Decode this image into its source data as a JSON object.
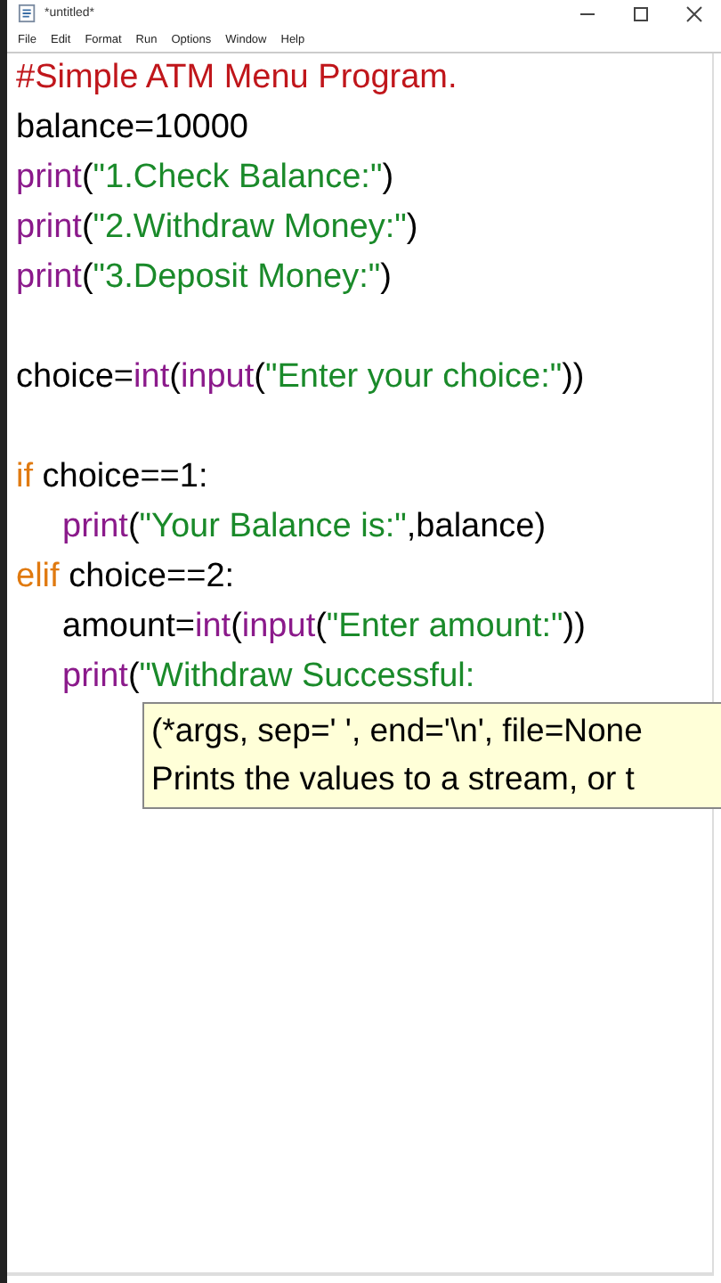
{
  "window": {
    "title": "*untitled*",
    "controls": [
      {
        "kind": "minimize"
      },
      {
        "kind": "maximize"
      },
      {
        "kind": "close"
      }
    ]
  },
  "menu": [
    "File",
    "Edit",
    "Format",
    "Run",
    "Options",
    "Window",
    "Help"
  ],
  "editor": {
    "lines": [
      {
        "kind": "code",
        "tokens": [
          {
            "kind": "comment",
            "text": "#Simple ATM Menu Program."
          }
        ]
      },
      {
        "kind": "code",
        "tokens": [
          {
            "kind": "plain",
            "text": "balance=10000"
          }
        ]
      },
      {
        "kind": "code",
        "tokens": [
          {
            "kind": "builtin",
            "text": "print"
          },
          {
            "kind": "plain",
            "text": "("
          },
          {
            "kind": "string",
            "text": "\"1.Check Balance:\""
          },
          {
            "kind": "plain",
            "text": ")"
          }
        ]
      },
      {
        "kind": "code",
        "tokens": [
          {
            "kind": "builtin",
            "text": "print"
          },
          {
            "kind": "plain",
            "text": "("
          },
          {
            "kind": "string",
            "text": "\"2.Withdraw Money:\""
          },
          {
            "kind": "plain",
            "text": ")"
          }
        ]
      },
      {
        "kind": "code",
        "tokens": [
          {
            "kind": "builtin",
            "text": "print"
          },
          {
            "kind": "plain",
            "text": "("
          },
          {
            "kind": "string",
            "text": "\"3.Deposit Money:\""
          },
          {
            "kind": "plain",
            "text": ")"
          }
        ]
      },
      {
        "kind": "blank"
      },
      {
        "kind": "code",
        "tokens": [
          {
            "kind": "plain",
            "text": "choice="
          },
          {
            "kind": "builtin",
            "text": "int"
          },
          {
            "kind": "plain",
            "text": "("
          },
          {
            "kind": "builtin",
            "text": "input"
          },
          {
            "kind": "plain",
            "text": "("
          },
          {
            "kind": "string",
            "text": "\"Enter your choice:\""
          },
          {
            "kind": "plain",
            "text": "))"
          }
        ]
      },
      {
        "kind": "blank"
      },
      {
        "kind": "code",
        "tokens": [
          {
            "kind": "keyword",
            "text": "if"
          },
          {
            "kind": "plain",
            "text": " choice==1:"
          }
        ],
        "children": [
          {
            "kind": "code",
            "tokens": [
              {
                "kind": "builtin",
                "text": "print"
              },
              {
                "kind": "plain",
                "text": "("
              },
              {
                "kind": "string",
                "text": "\"Your Balance is:\""
              },
              {
                "kind": "plain",
                "text": ",balance)"
              }
            ]
          }
        ]
      },
      {
        "kind": "code",
        "tokens": [
          {
            "kind": "keyword",
            "text": "elif"
          },
          {
            "kind": "plain",
            "text": " choice==2:"
          }
        ],
        "children": [
          {
            "kind": "code",
            "tokens": [
              {
                "kind": "plain",
                "text": "amount="
              },
              {
                "kind": "builtin",
                "text": "int"
              },
              {
                "kind": "plain",
                "text": "("
              },
              {
                "kind": "builtin",
                "text": "input"
              },
              {
                "kind": "plain",
                "text": "("
              },
              {
                "kind": "string",
                "text": "\"Enter amount:\""
              },
              {
                "kind": "plain",
                "text": "))"
              }
            ]
          },
          {
            "kind": "code",
            "tokens": [
              {
                "kind": "builtin",
                "text": "print"
              },
              {
                "kind": "plain",
                "text": "("
              },
              {
                "kind": "string",
                "text": "\"Withdraw Successful:"
              }
            ]
          }
        ]
      }
    ],
    "calltip": [
      "(*args, sep=' ', end='\\n', file=None",
      "Prints the values to a stream, or t"
    ]
  }
}
